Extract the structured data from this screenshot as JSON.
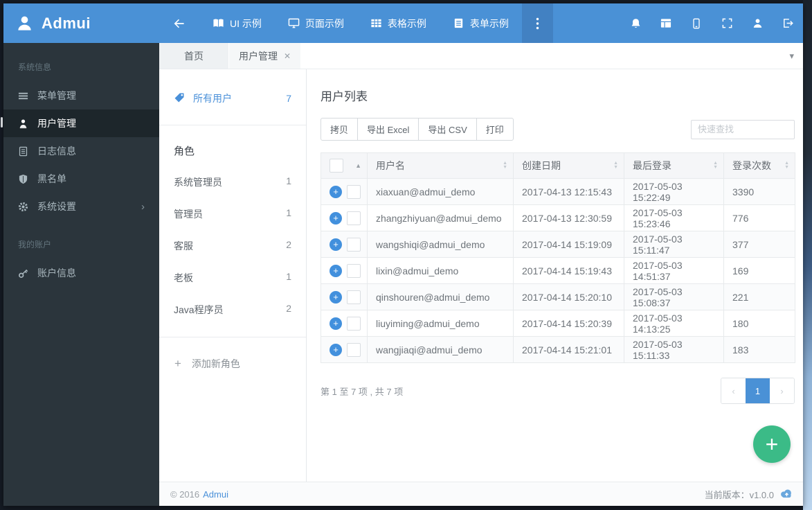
{
  "colors": {
    "navbar_blue": "#4a91d6",
    "navbar_more_bg": "#4281c2",
    "sidebar_dark": "#2b353c",
    "sidebar_active_bg": "#1d262b",
    "accent_blue": "#4a90d9",
    "fab_green": "#3bbb87",
    "zebra_row": "#fafbfc",
    "header_row": "#f5f6f8"
  },
  "icons": {
    "plus": "+",
    "close": "✕",
    "caret_down": "▾",
    "chevron_right": "›",
    "sort_asc": "▲",
    "sort_desc": "▼",
    "pager_prev": "‹",
    "pager_next": "›"
  },
  "topbar": {
    "brand": "Admui",
    "nav_items": [
      {
        "label": "UI 示例",
        "icon": "book-icon"
      },
      {
        "label": "页面示例",
        "icon": "monitor-icon"
      },
      {
        "label": "表格示例",
        "icon": "table-icon"
      },
      {
        "label": "表单示例",
        "icon": "form-icon"
      }
    ]
  },
  "sidebar": {
    "sections": [
      {
        "label": "系统信息",
        "items": [
          {
            "label": "菜单管理",
            "icon": "menu-icon"
          },
          {
            "label": "用户管理",
            "icon": "user-icon",
            "active": true
          },
          {
            "label": "日志信息",
            "icon": "log-icon"
          },
          {
            "label": "黑名单",
            "icon": "shield-icon"
          },
          {
            "label": "系统设置",
            "icon": "gear-icon",
            "has_submenu": true
          }
        ]
      },
      {
        "label": "我的账户",
        "items": [
          {
            "label": "账户信息",
            "icon": "key-icon"
          }
        ]
      }
    ]
  },
  "tabs": {
    "home": "首页",
    "current": "用户管理"
  },
  "filter_panel": {
    "all_users": {
      "label": "所有用户",
      "count": "7"
    },
    "roles_header": "角色",
    "roles": [
      {
        "name": "系统管理员",
        "count": "1"
      },
      {
        "name": "管理员",
        "count": "1"
      },
      {
        "name": "客服",
        "count": "2"
      },
      {
        "name": "老板",
        "count": "1"
      },
      {
        "name": "Java程序员",
        "count": "2"
      }
    ],
    "add_role": "添加新角色"
  },
  "main": {
    "title": "用户列表",
    "toolbar": {
      "copy": "拷贝",
      "excel": "导出 Excel",
      "csv": "导出 CSV",
      "print": "打印",
      "search_placeholder": "快速查找"
    },
    "table": {
      "columns": [
        "用户名",
        "创建日期",
        "最后登录",
        "登录次数"
      ],
      "rows": [
        {
          "username": "xiaxuan@admui_demo",
          "created": "2017-04-13 12:15:43",
          "last_login": "2017-05-03 15:22:49",
          "logins": "3390"
        },
        {
          "username": "zhangzhiyuan@admui_demo",
          "created": "2017-04-13 12:30:59",
          "last_login": "2017-05-03 15:23:46",
          "logins": "776"
        },
        {
          "username": "wangshiqi@admui_demo",
          "created": "2017-04-14 15:19:09",
          "last_login": "2017-05-03 15:11:47",
          "logins": "377"
        },
        {
          "username": "lixin@admui_demo",
          "created": "2017-04-14 15:19:43",
          "last_login": "2017-05-03 14:51:37",
          "logins": "169"
        },
        {
          "username": "qinshouren@admui_demo",
          "created": "2017-04-14 15:20:10",
          "last_login": "2017-05-03 15:08:37",
          "logins": "221"
        },
        {
          "username": "liuyiming@admui_demo",
          "created": "2017-04-14 15:20:39",
          "last_login": "2017-05-03 14:13:25",
          "logins": "180"
        },
        {
          "username": "wangjiaqi@admui_demo",
          "created": "2017-04-14 15:21:01",
          "last_login": "2017-05-03 15:11:33",
          "logins": "183"
        }
      ]
    },
    "pagination": {
      "info": "第 1 至 7 项 , 共 7 项",
      "page": "1"
    }
  },
  "footer": {
    "copyright": "© 2016",
    "brand": "Admui",
    "version": "当前版本：v1.0.0"
  }
}
